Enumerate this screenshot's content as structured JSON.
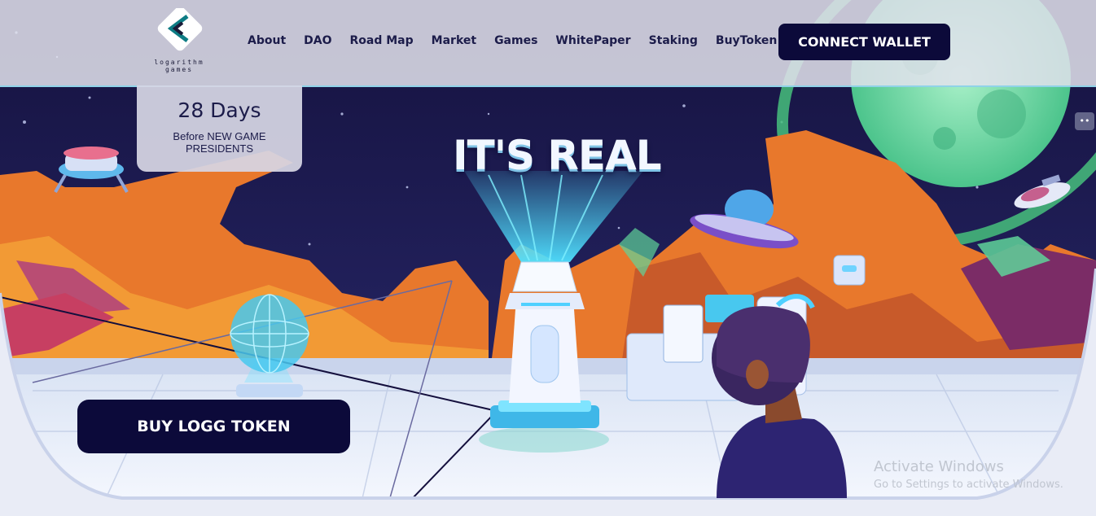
{
  "logo": {
    "text": "logarithm\ngames",
    "icon": "chevron-left-icon"
  },
  "nav": {
    "items": [
      "About",
      "DAO",
      "Road Map",
      "Market",
      "Games",
      "WhitePaper",
      "Staking",
      "BuyToken"
    ]
  },
  "header": {
    "connect_label": "CONNECT WALLET"
  },
  "countdown": {
    "days": "28 Days",
    "caption": "Before NEW GAME PRESIDENTS"
  },
  "hero": {
    "headline": "IT'S REAL",
    "buy_label": "BUY LOGG TOKEN"
  },
  "windows_notice": {
    "title": "Activate Windows",
    "subtitle": "Go to Settings to activate Windows."
  },
  "colors": {
    "navy": "#0c0a3a",
    "nav_text": "#1c1c4a",
    "space": "#15123f",
    "rock_orange": "#e8782c",
    "planet_green": "#5fd49a",
    "holo_cyan": "#4fe0ff"
  }
}
